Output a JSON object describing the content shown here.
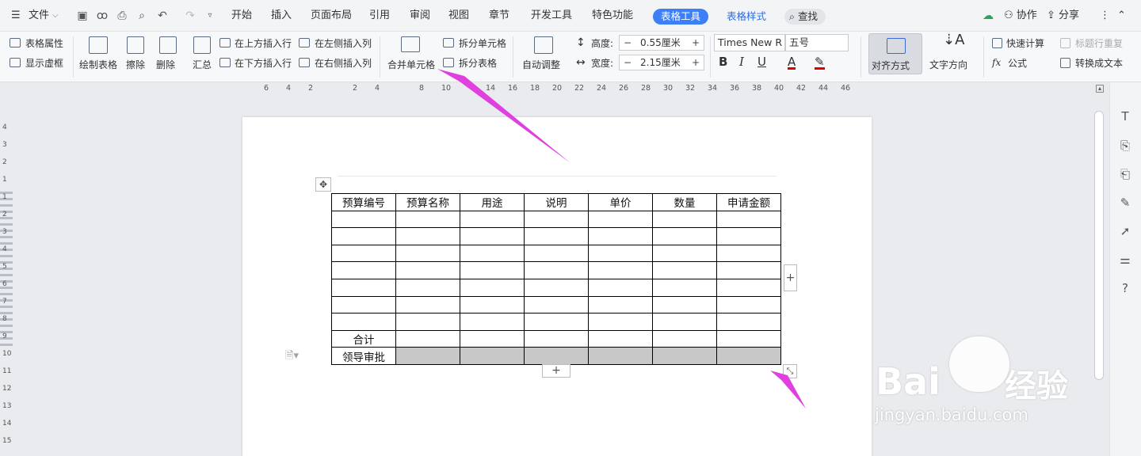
{
  "menubar": {
    "file": "文件",
    "items": [
      "开始",
      "插入",
      "页面布局",
      "引用",
      "审阅",
      "视图",
      "章节",
      "开发工具",
      "特色功能"
    ],
    "active_tab": "表格工具",
    "style_tab": "表格样式",
    "search": "查找",
    "collab": "协作",
    "share": "分享"
  },
  "ribbon": {
    "table_props": "表格属性",
    "show_grid": "显示虚框",
    "draw_table": "绘制表格",
    "erase": "擦除",
    "delete": "删除",
    "summary": "汇总",
    "insert_above": "在上方插入行",
    "insert_below": "在下方插入行",
    "insert_left": "在左侧插入列",
    "insert_right": "在右侧插入列",
    "merge": "合并单元格",
    "split_cells": "拆分单元格",
    "split_table": "拆分表格",
    "auto_fit": "自动调整",
    "height_label": "高度:",
    "height_value": "0.55厘米",
    "width_label": "宽度:",
    "width_value": "2.15厘米",
    "font_name": "Times New R",
    "font_size": "五号",
    "bold": "B",
    "italic": "I",
    "underline": "U",
    "font_color_a": "A",
    "align": "对齐方式",
    "text_dir": "文字方向",
    "quick_calc": "快速计算",
    "repeat_header": "标题行重复",
    "formula": "公式",
    "to_text": "转换成文本"
  },
  "ruler": {
    "h_numbers": [
      "6",
      "4",
      "2",
      "2",
      "4",
      "8",
      "10",
      "14",
      "16",
      "18",
      "20",
      "22",
      "24",
      "26",
      "28",
      "30",
      "32",
      "34",
      "36",
      "38",
      "40",
      "42",
      "44",
      "46"
    ],
    "v_numbers": [
      "4",
      "3",
      "2",
      "1",
      "1",
      "2",
      "3",
      "4",
      "5",
      "6",
      "7",
      "8",
      "9",
      "10",
      "11",
      "12",
      "13",
      "14",
      "15"
    ]
  },
  "table": {
    "headers": [
      "预算编号",
      "预算名称",
      "用途",
      "说明",
      "单价",
      "数量",
      "申请金额"
    ],
    "blank_rows": 7,
    "total_label": "合计",
    "approval_label": "领导审批"
  },
  "watermark": {
    "brand": "Bai",
    "brand2": "经验",
    "url": "jingyan.baidu.com"
  },
  "colors": {
    "accent": "#3d7ff5",
    "arrow": "#e040e0",
    "shade": "#c8c8c8"
  }
}
